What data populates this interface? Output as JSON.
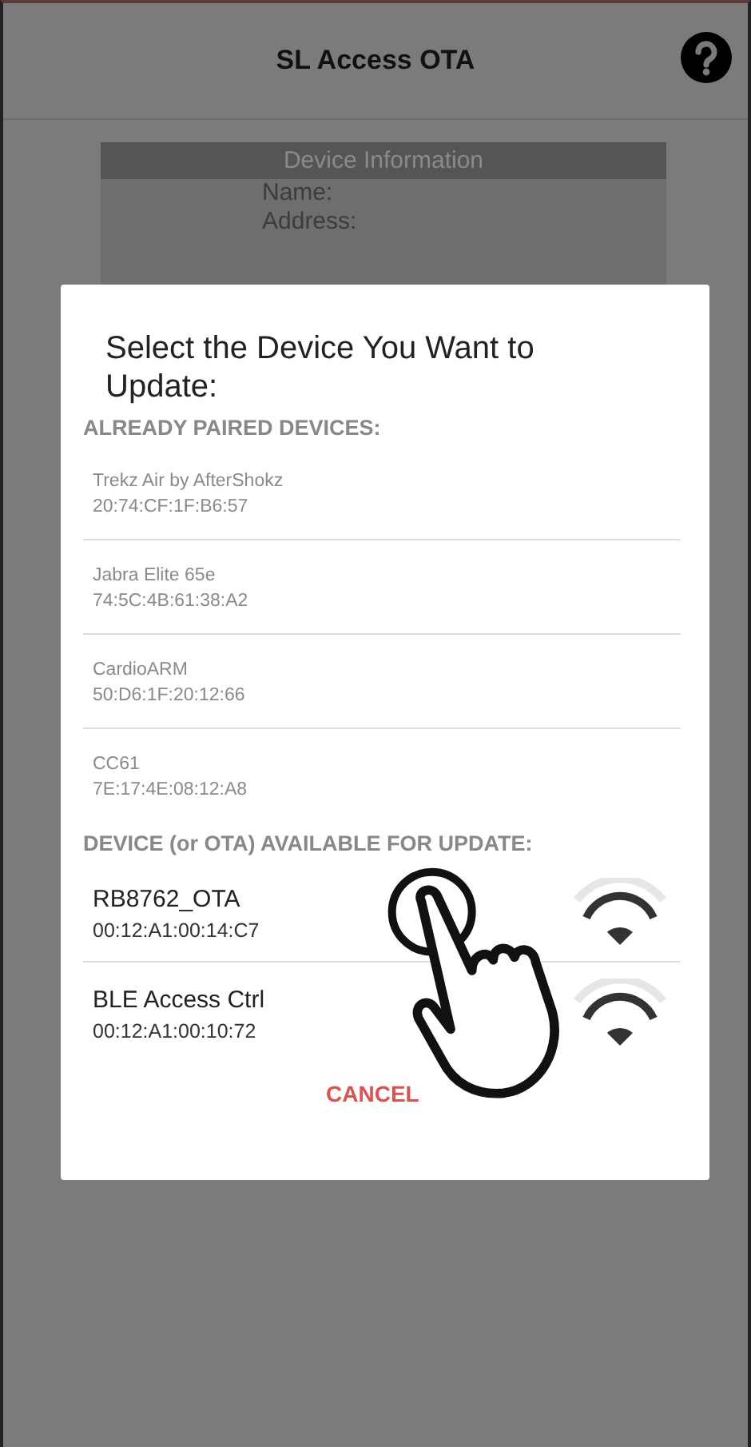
{
  "header": {
    "title": "SL Access OTA"
  },
  "device_info": {
    "title": "Device Information",
    "labels": [
      "Name:",
      "Address:"
    ]
  },
  "dialog": {
    "title": "Select the Device You Want to Update:",
    "sections": [
      {
        "heading": "ALREADY PAIRED DEVICES:",
        "devices": [
          {
            "name": "Trekz Air by AfterShokz",
            "address": "20:74:CF:1F:B6:57",
            "faded": true
          },
          {
            "name": "Jabra Elite 65e",
            "address": "74:5C:4B:61:38:A2",
            "faded": true
          },
          {
            "name": "CardioARM",
            "address": "50:D6:1F:20:12:66",
            "faded": true
          },
          {
            "name": "CC61",
            "address": "7E:17:4E:08:12:A8",
            "faded": true
          }
        ]
      },
      {
        "heading": "DEVICE (or OTA) AVAILABLE FOR UPDATE:",
        "devices": [
          {
            "name": "RB8762_OTA",
            "address": "00:12:A1:00:14:C7",
            "faded": false,
            "kind": "ota"
          },
          {
            "name": "BLE Access Ctrl",
            "address": "00:12:A1:00:10:72",
            "faded": false,
            "kind": "ota"
          }
        ]
      }
    ],
    "cancel": "CANCEL"
  }
}
